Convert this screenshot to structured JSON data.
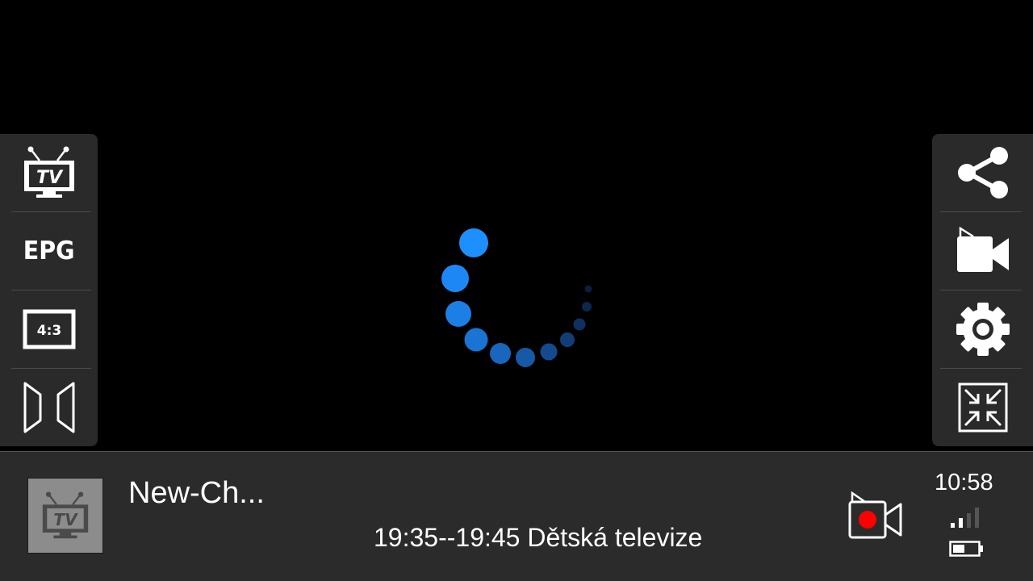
{
  "left_panel": {
    "tv_icon_text": "TV",
    "epg_label": "EPG",
    "aspect_label": "4:3"
  },
  "right_panel": {
    "buttons": [
      "share-icon",
      "video-camera-icon",
      "gear-icon",
      "collapse-arrows-icon"
    ]
  },
  "player": {
    "channel_name": "New-Ch...",
    "programme": "19:35--19:45 Dětská televize",
    "thumb_tv_text": "TV"
  },
  "status": {
    "time": "10:58"
  },
  "colors": {
    "panel_bg": "#2a2a2a",
    "spinner_blue": "#1e8fff",
    "record_red": "#ff0000"
  }
}
